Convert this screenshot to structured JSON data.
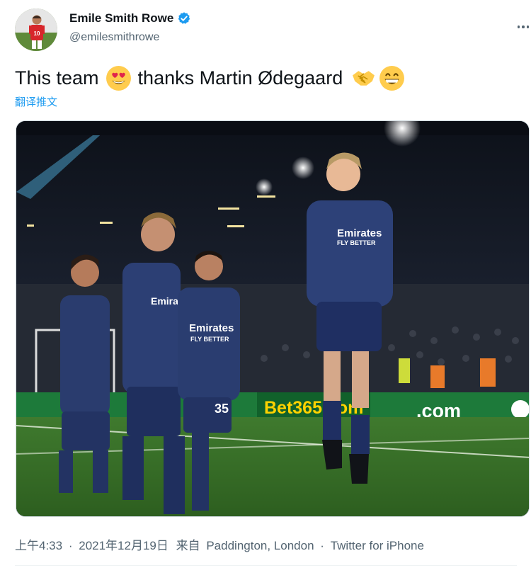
{
  "author": {
    "display_name": "Emile Smith Rowe",
    "handle": "@emilesmithrowe",
    "verified_icon": "verified-badge",
    "avatar_jersey_number": "10"
  },
  "tweet": {
    "text_parts": [
      "This team",
      "thanks Martin Ødegaard"
    ],
    "emojis": [
      "heart-eyes-emoji",
      "handshake-emoji",
      "grinning-emoji"
    ],
    "translate_label": "翻译推文"
  },
  "media": {
    "ad_boards": [
      "Bet365.com",
      ".com"
    ],
    "shirt_sponsor_line1": "Emirates",
    "shirt_sponsor_line2": "FLY BETTER",
    "player_number": "35"
  },
  "meta": {
    "time": "上午4:33",
    "separator": "·",
    "date": "2021年12月19日",
    "from_label": "来自",
    "location": "Paddington, London",
    "source": "Twitter for iPhone"
  },
  "colors": {
    "accent": "#1d9bf0",
    "text_primary": "#0f1419",
    "text_secondary": "#536471"
  }
}
